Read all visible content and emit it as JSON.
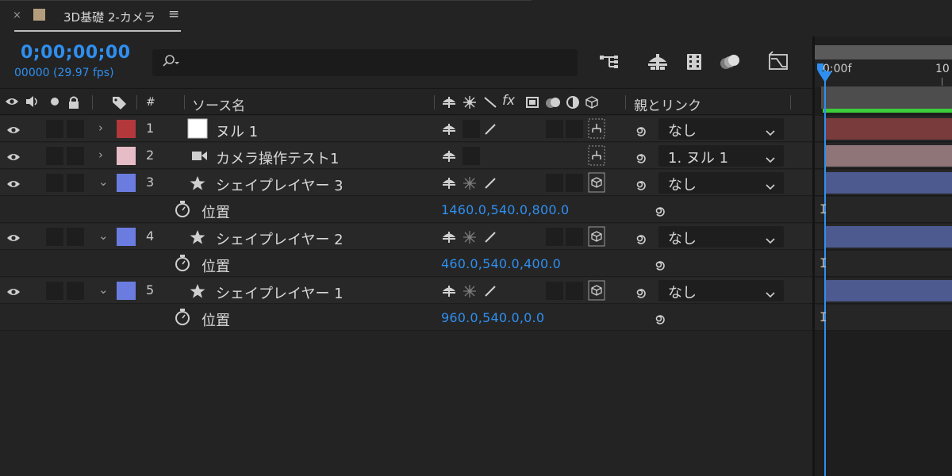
{
  "tab": {
    "close": "×",
    "title": "3D基礎 2-カメラ",
    "menu": "≡",
    "swatch_color": "#b49d7c"
  },
  "time": {
    "timecode": "0;00;00;00",
    "frames_fps": "00000 (29.97 fps)"
  },
  "search": {
    "placeholder": ""
  },
  "header": {
    "num": "#",
    "source_name": "ソース名",
    "fx": "fx",
    "parent_link": "親とリンク"
  },
  "layers": [
    {
      "num": "1",
      "name": "ヌル 1",
      "label_color": "#b2383b",
      "icon": "null-square-icon",
      "expanded": false,
      "parent": "なし"
    },
    {
      "num": "2",
      "name": "カメラ操作テスト1",
      "label_color": "#e6bcc6",
      "icon": "camera-icon",
      "expanded": false,
      "parent": "1. ヌル 1"
    },
    {
      "num": "3",
      "name": "シェイプレイヤー 3",
      "label_color": "#6b7ce0",
      "icon": "star-icon",
      "expanded": true,
      "parent": "なし",
      "property": "位置",
      "value": "1460.0,540.0,800.0"
    },
    {
      "num": "4",
      "name": "シェイプレイヤー 2",
      "label_color": "#6b7ce0",
      "icon": "star-icon",
      "expanded": true,
      "parent": "なし",
      "property": "位置",
      "value": "460.0,540.0,400.0"
    },
    {
      "num": "5",
      "name": "シェイプレイヤー 1",
      "label_color": "#6b7ce0",
      "icon": "star-icon",
      "expanded": true,
      "parent": "なし",
      "property": "位置",
      "value": "960.0,540.0,0.0"
    }
  ],
  "timeline": {
    "ruler_start": "0:00f",
    "ruler_next": "10",
    "bar_colors": [
      "#7a3b3c",
      "#8f7478",
      "#4d5a8f",
      "#4d5a8f",
      "#4d5a8f"
    ],
    "playhead_color": "#2f8ff0"
  }
}
